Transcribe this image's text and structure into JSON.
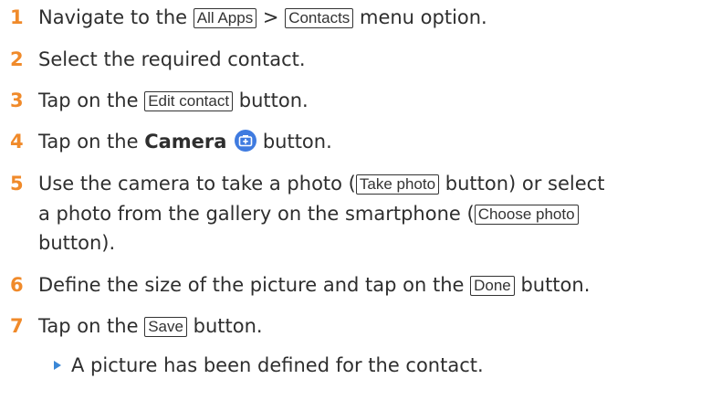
{
  "steps": [
    {
      "num": "1",
      "t1": "Navigate to the",
      "b1": "All Apps",
      "t2": ">",
      "b2": "Contacts",
      "t3": "menu option."
    },
    {
      "num": "2",
      "t1": "Select the required contact."
    },
    {
      "num": "3",
      "t1": "Tap on the",
      "b1": "Edit contact",
      "t2": "button."
    },
    {
      "num": "4",
      "t1": "Tap on the",
      "bold": "Camera",
      "icon": "camera-plus-icon",
      "t2": "button."
    },
    {
      "num": "5",
      "t1": "Use the camera to take a photo (",
      "b1": "Take photo",
      "t2": "button) or select",
      "t3": "a photo from the gallery on the smartphone (",
      "b2": "Choose photo",
      "t4": "button)."
    },
    {
      "num": "6",
      "t1": "Define the size of the picture and tap on the",
      "b1": "Done",
      "t2": "button."
    },
    {
      "num": "7",
      "t1": "Tap on the",
      "b1": "Save",
      "t2": "button."
    }
  ],
  "result": "A picture has been defined for the contact.",
  "colors": {
    "step_number": "#f08a2a",
    "result_arrow": "#3a87d6",
    "camera_icon": "#3f7be0"
  }
}
